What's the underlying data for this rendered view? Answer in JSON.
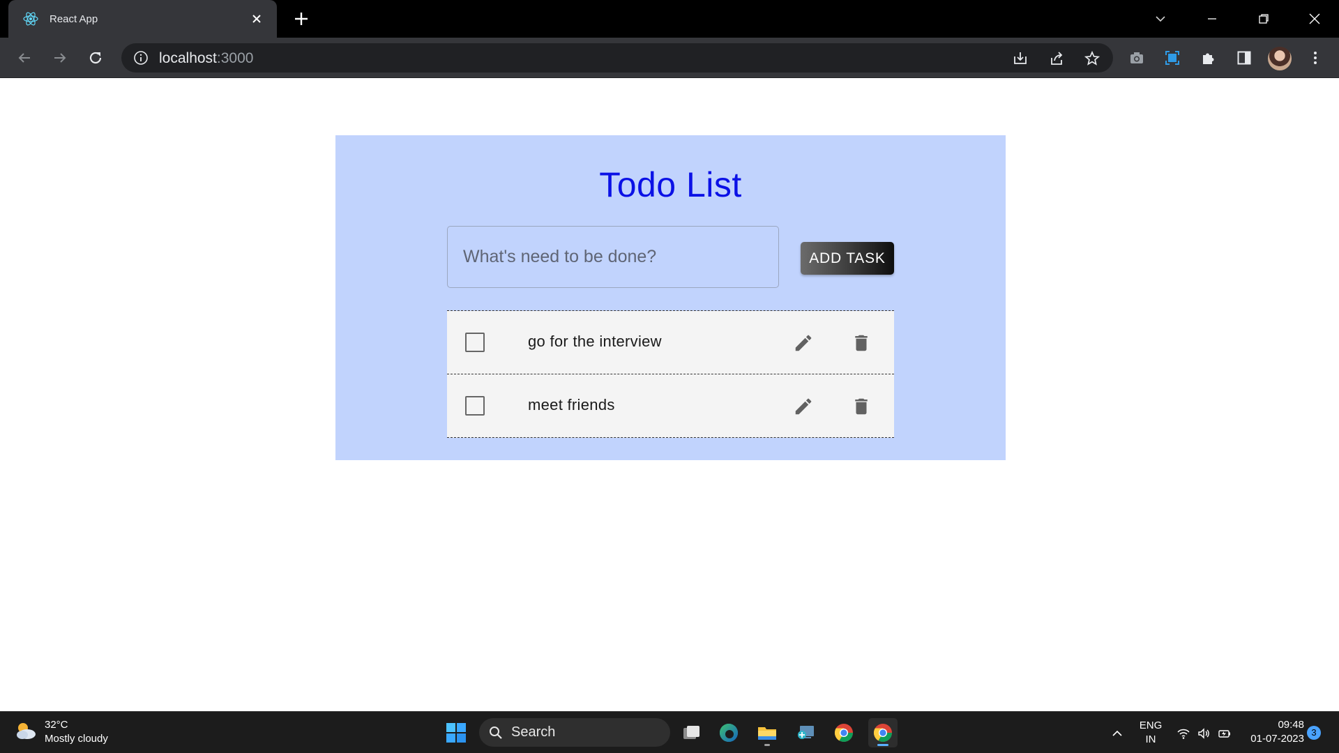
{
  "browser": {
    "tab_title": "React App",
    "url_host": "localhost",
    "url_port": ":3000"
  },
  "app": {
    "title": "Todo List",
    "input_placeholder": "What's need to be done?",
    "input_value": "",
    "add_button_label": "ADD TASK",
    "todos": [
      {
        "text": "go for the interview",
        "done": false
      },
      {
        "text": "meet friends",
        "done": false
      }
    ],
    "colors": {
      "card_background": "#c1d3fd",
      "title": "#0b11e6",
      "item_background": "#f4f4f4"
    }
  },
  "taskbar": {
    "weather_temp": "32°C",
    "weather_desc": "Mostly cloudy",
    "search_label": "Search",
    "lang_line1": "ENG",
    "lang_line2": "IN",
    "time": "09:48",
    "date": "01-07-2023",
    "notification_count": "3"
  }
}
